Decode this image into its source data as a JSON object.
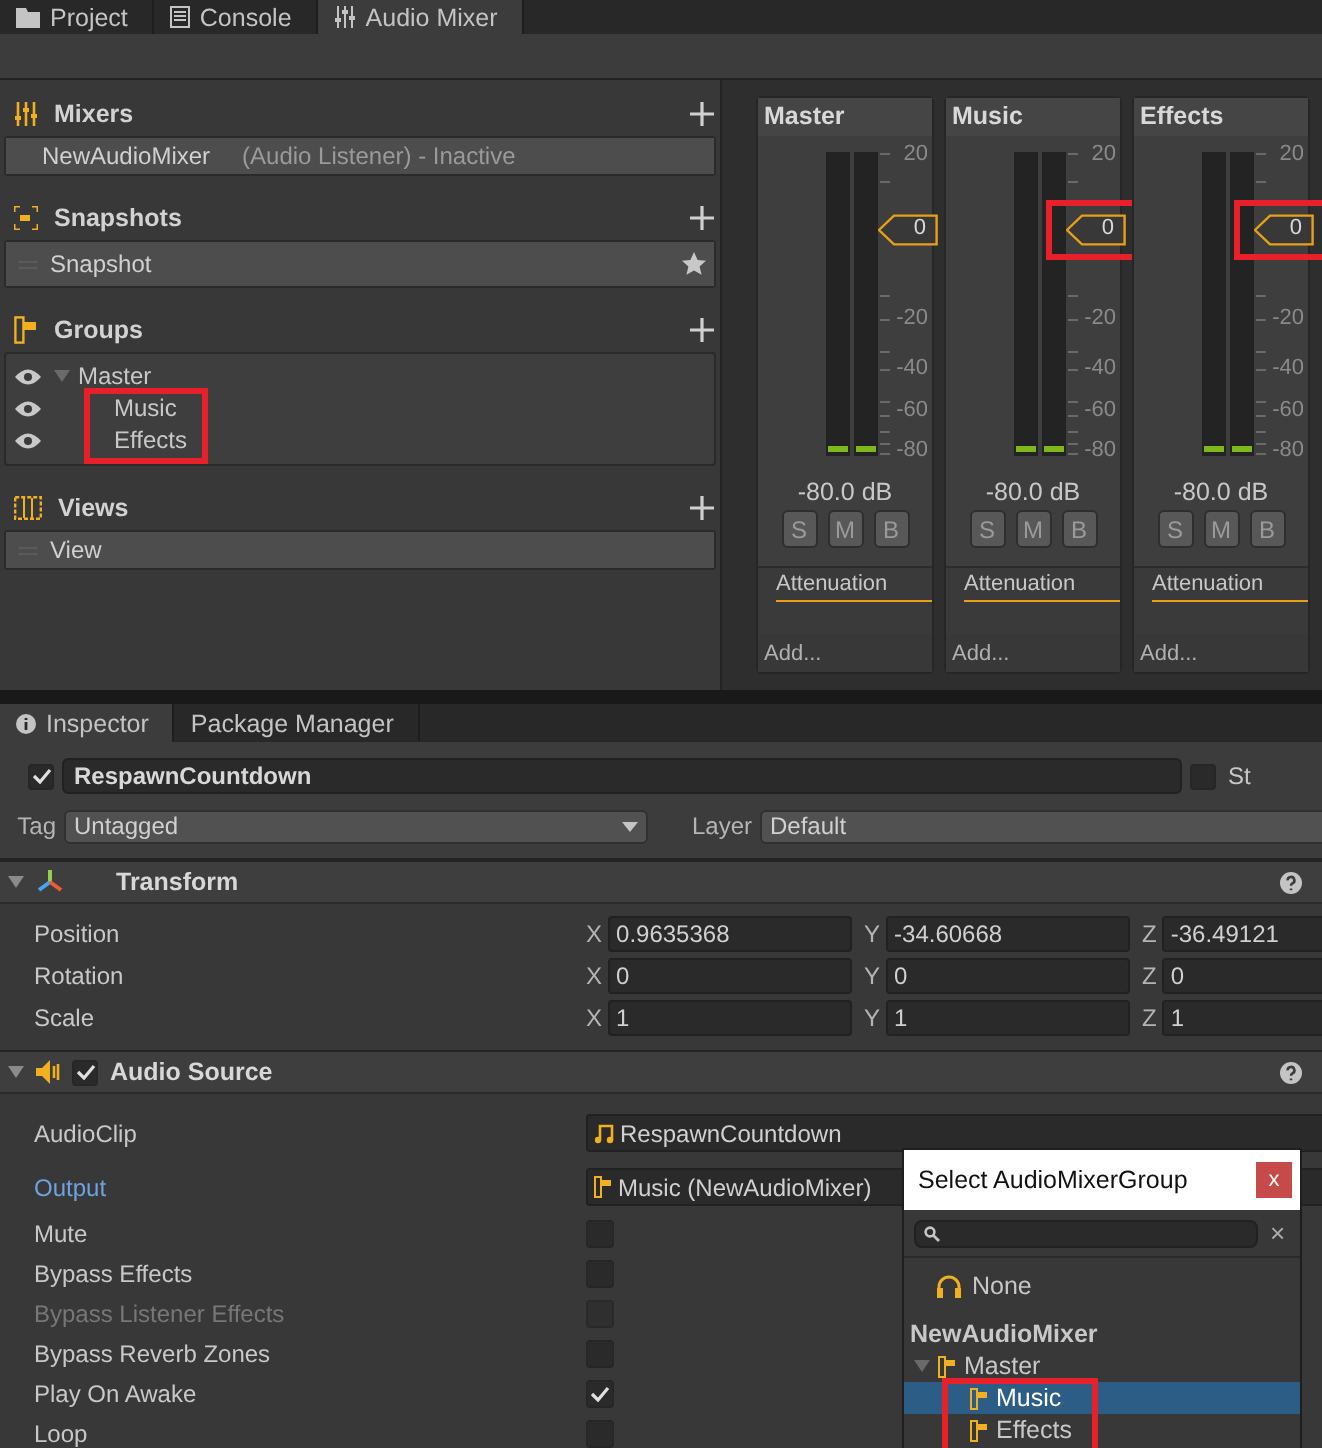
{
  "tabs": [
    {
      "label": "Project",
      "kind": "folder",
      "selected": false
    },
    {
      "label": "Console",
      "kind": "console",
      "selected": false
    },
    {
      "label": "Audio Mixer",
      "kind": "mixer",
      "selected": true
    }
  ],
  "mixers": {
    "title": "Mixers",
    "items": [
      {
        "name": "NewAudioMixer",
        "note": "(Audio Listener) - Inactive"
      }
    ]
  },
  "snapshots": {
    "title": "Snapshots",
    "items": [
      {
        "name": "Snapshot",
        "starred": true
      }
    ]
  },
  "groups": {
    "title": "Groups",
    "tree": [
      {
        "name": "Master",
        "visible": true,
        "expanded": true,
        "highlight_children": true,
        "children": [
          {
            "name": "Music",
            "visible": true
          },
          {
            "name": "Effects",
            "visible": true
          }
        ]
      }
    ]
  },
  "views": {
    "title": "Views",
    "items": [
      {
        "name": "View"
      }
    ]
  },
  "strips": [
    {
      "name": "Master",
      "fader": "0",
      "fader_highlighted": false,
      "scale": [
        "20",
        "-20",
        "-40",
        "-60",
        "-80"
      ],
      "reading": "-80.0 dB",
      "buttons": [
        "S",
        "M",
        "B"
      ],
      "effects": [
        "Attenuation"
      ],
      "add": "Add..."
    },
    {
      "name": "Music",
      "fader": "0",
      "fader_highlighted": true,
      "scale": [
        "20",
        "-20",
        "-40",
        "-60",
        "-80"
      ],
      "reading": "-80.0 dB",
      "buttons": [
        "S",
        "M",
        "B"
      ],
      "effects": [
        "Attenuation"
      ],
      "add": "Add..."
    },
    {
      "name": "Effects",
      "fader": "0",
      "fader_highlighted": true,
      "scale": [
        "20",
        "-20",
        "-40",
        "-60",
        "-80"
      ],
      "reading": "-80.0 dB",
      "buttons": [
        "S",
        "M",
        "B"
      ],
      "effects": [
        "Attenuation"
      ],
      "add": "Add..."
    }
  ],
  "inspector_tabs": [
    {
      "label": "Inspector",
      "kind": "info",
      "selected": true
    },
    {
      "label": "Package Manager",
      "kind": "plain",
      "selected": false
    }
  ],
  "object": {
    "active": true,
    "name": "RespawnCountdown",
    "static_label": "St",
    "static": false,
    "tag_label": "Tag",
    "tag": "Untagged",
    "layer_label": "Layer",
    "layer": "Default"
  },
  "components": [
    {
      "kind": "transform",
      "title": "Transform",
      "expanded": true,
      "rows": [
        {
          "kind": "vector",
          "label": "Position",
          "axes": [
            {
              "axis": "X",
              "value": "0.9635368"
            },
            {
              "axis": "Y",
              "value": "-34.60668"
            },
            {
              "axis": "Z",
              "value": "-36.49121"
            }
          ]
        },
        {
          "kind": "vector",
          "label": "Rotation",
          "axes": [
            {
              "axis": "X",
              "value": "0"
            },
            {
              "axis": "Y",
              "value": "0"
            },
            {
              "axis": "Z",
              "value": "0"
            }
          ]
        },
        {
          "kind": "vector",
          "label": "Scale",
          "axes": [
            {
              "axis": "X",
              "value": "1"
            },
            {
              "axis": "Y",
              "value": "1"
            },
            {
              "axis": "Z",
              "value": "1"
            }
          ]
        }
      ]
    },
    {
      "kind": "audio",
      "title": "Audio Source",
      "enabled": true,
      "expanded": true,
      "rows": [
        {
          "kind": "object",
          "label": "AudioClip",
          "value": "RespawnCountdown",
          "focused": false
        },
        {
          "kind": "object",
          "label": "Output",
          "value": "Music (NewAudioMixer)",
          "focused": true
        },
        {
          "kind": "toggle",
          "label": "Mute",
          "checked": false,
          "disabled": false
        },
        {
          "kind": "toggle",
          "label": "Bypass Effects",
          "checked": false,
          "disabled": false
        },
        {
          "kind": "toggle",
          "label": "Bypass Listener Effects",
          "checked": false,
          "disabled": true
        },
        {
          "kind": "toggle",
          "label": "Bypass Reverb Zones",
          "checked": false,
          "disabled": false
        },
        {
          "kind": "toggle",
          "label": "Play On Awake",
          "checked": true,
          "disabled": false
        },
        {
          "kind": "toggle",
          "label": "Loop",
          "checked": false,
          "disabled": false
        }
      ]
    }
  ],
  "popup": {
    "title": "Select AudioMixerGroup",
    "close": "x",
    "clear": "×",
    "none": "None",
    "mixer": "NewAudioMixer",
    "tree": [
      {
        "name": "Master",
        "expanded": true,
        "highlight_children": true,
        "children": [
          {
            "name": "Music",
            "selected": true
          },
          {
            "name": "Effects",
            "selected": false
          }
        ]
      }
    ]
  }
}
